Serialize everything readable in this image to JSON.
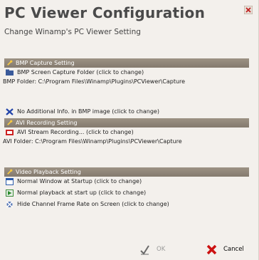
{
  "window": {
    "title": "PC Viewer Configuration",
    "subtitle": "Change Winamp's PC Viewer Setting"
  },
  "bmp_section": {
    "header": "BMP Capture Setting",
    "folder_label": "BMP Screen Capture Folder (click to change)",
    "folder_path": "BMP Folder: C:\\Program Files\\Winamp\\Plugins\\PCViewer\\Capture",
    "additional_info": "No Additional Info. in BMP image (click to change)"
  },
  "avi_section": {
    "header": "AVI Recording Setting",
    "status_label": "AVI Stream Recording... (click to change)",
    "folder_path": "AVI Folder: C:\\Program Files\\Winamp\\Plugins\\PCViewer\\Capture"
  },
  "video_section": {
    "header": "Video Playback Setting",
    "window_startup": "Normal Window at Startup (click to change)",
    "playback_startup": "Normal playback at start up (click to change)",
    "frame_rate": "Hide Channel Frame Rate on Screen (click to change)"
  },
  "footer": {
    "ok_label": "OK",
    "cancel_label": "Cancel"
  },
  "colors": {
    "header_bar": "#8c8275",
    "cancel_red": "#cc1111"
  }
}
